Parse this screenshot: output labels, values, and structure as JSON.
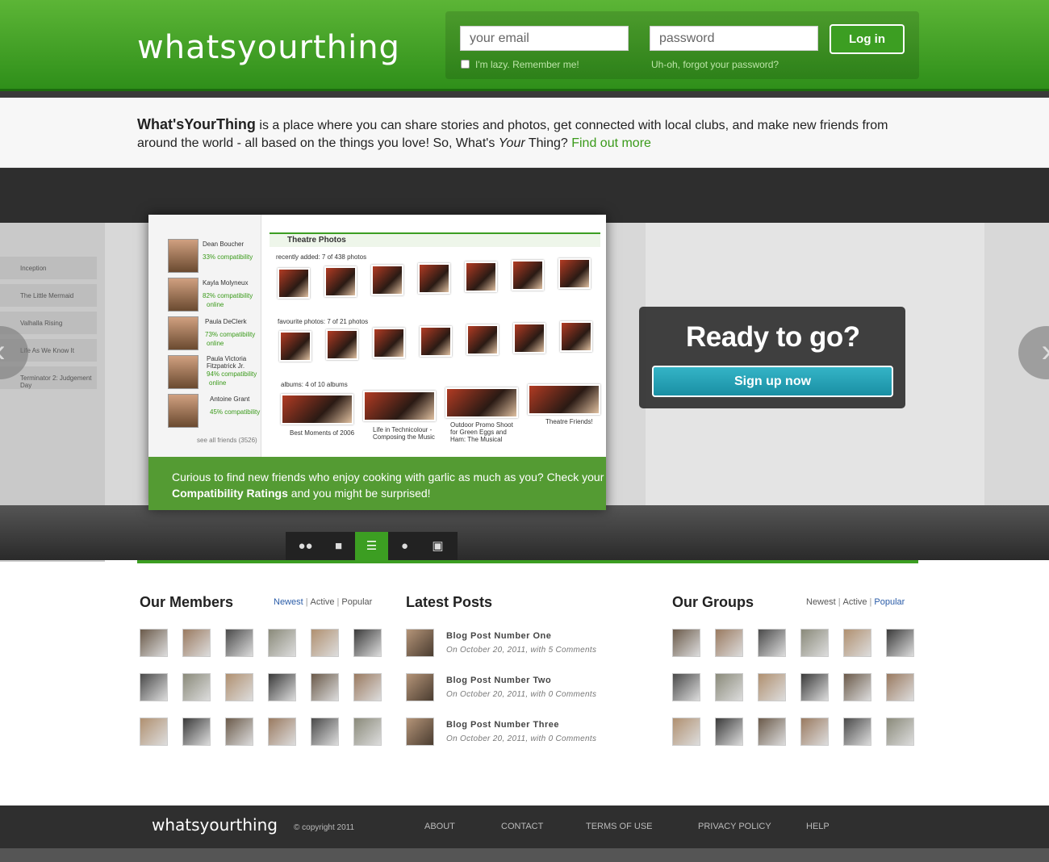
{
  "header": {
    "logo": "whatsyourthing",
    "email_placeholder": "your email",
    "password_placeholder": "password",
    "login_label": "Log in",
    "remember_label": "I'm lazy. Remember me!",
    "forgot_label": "Uh-oh, forgot your password?"
  },
  "intro": {
    "brand": "What'sYourThing",
    "text1": " is a place where you can share stories and photos, get connected with local clubs, and make new friends from around the world - all based on the things you love! So, What's ",
    "your": "Your",
    "text2": " Thing? ",
    "link": "Find out more"
  },
  "showcase": {
    "section_title": "Theatre Photos",
    "recent_label": "recently added: 7 of 438 photos",
    "fav_label": "favourite photos: 7 of 21 photos",
    "albums_label": "albums: 4 of 10 albums",
    "friends": [
      {
        "name": "Dean Boucher",
        "compat": "33% compatibility",
        "status": ""
      },
      {
        "name": "Kayla Molyneux",
        "compat": "82% compatibility",
        "status": "online"
      },
      {
        "name": "Paula DeClerk",
        "compat": "73% compatibility",
        "status": "online"
      },
      {
        "name": "Paula Victoria Fitzpatrick Jr.",
        "compat": "94% compatibility",
        "status": "online"
      },
      {
        "name": "Antoine Grant",
        "compat": "45% compatibility",
        "status": ""
      }
    ],
    "see_all": "see all friends (3526)",
    "albums": [
      "Best Moments of 2006",
      "Life in Technicolour - Composing the Music",
      "Outdoor Promo Shoot for Green Eggs and Ham: The Musical",
      "Theatre Friends!"
    ],
    "caption_1": "Curious to find new friends who enjoy cooking with garlic as much as you? Check your ",
    "caption_bold": "Compatibility Ratings",
    "caption_2": " and you might be surprised!",
    "ready_title": "Ready to go?",
    "signup_label": "Sign up now",
    "bg_list": [
      "Inception",
      "The Little Mermaid",
      "Valhalla Rising",
      "Life As We Know It",
      "Terminator 2: Judgement Day"
    ]
  },
  "members": {
    "title": "Our Members",
    "filters": [
      "Newest",
      "Active",
      "Popular"
    ],
    "active_filter": "Newest"
  },
  "posts": {
    "title": "Latest Posts",
    "items": [
      {
        "title": "Blog Post Number One",
        "meta": "On October 20, 2011, with 5 Comments"
      },
      {
        "title": "Blog Post Number Two",
        "meta": "On October 20, 2011, with 0 Comments"
      },
      {
        "title": "Blog Post Number Three",
        "meta": "On October 20, 2011, with 0 Comments"
      }
    ]
  },
  "groups": {
    "title": "Our Groups",
    "filters": [
      "Newest",
      "Active",
      "Popular"
    ],
    "active_filter": "Popular"
  },
  "footer": {
    "logo": "whatsyourthing",
    "copyright": "© copyright 2011",
    "links": [
      "ABOUT",
      "CONTACT",
      "TERMS OF USE",
      "PRIVACY POLICY",
      "HELP"
    ]
  },
  "colors": {
    "brand_green": "#3c9e22",
    "signup_blue": "#1a8fa4",
    "link_blue": "#2a5ca8"
  }
}
